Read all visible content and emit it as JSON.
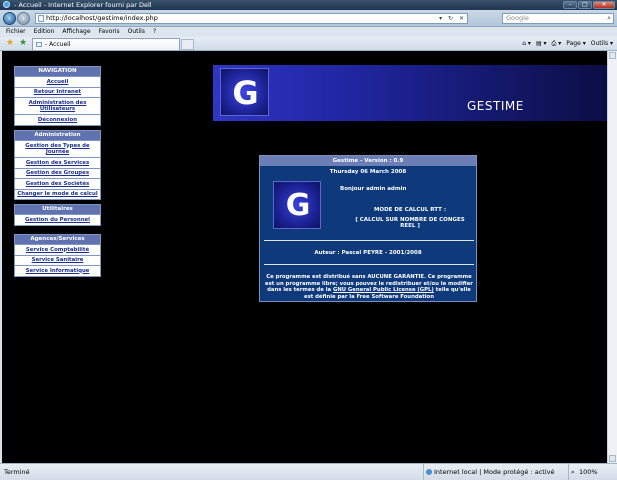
{
  "window": {
    "title": "- Accueil - Internet Explorer fourni par Dell",
    "controls": [
      "–",
      "□",
      "✕"
    ]
  },
  "addressbar": {
    "url": "http://localhost/gestime/index.php",
    "tail_icons": "▾ ↻ ✕",
    "search_placeholder": "Google",
    "search_icon": "⌕"
  },
  "menubar": [
    "Fichier",
    "Edition",
    "Affichage",
    "Favoris",
    "Outils",
    "?"
  ],
  "tab": {
    "label": "- Accueil"
  },
  "commandbar": [
    "⌂ ▾",
    "▤ ▾",
    "⎙ ▾",
    "Page ▾",
    "Outils ▾"
  ],
  "sidebar": {
    "navigation": {
      "heading": "NAVIGATION",
      "items": [
        "Accueil",
        "Retour Intranet",
        "Administration des Utilisateurs",
        "Déconnexion"
      ]
    },
    "administration": {
      "heading": "Administration",
      "items": [
        "Gestion des Types de Journée",
        "Gestion des Services",
        "Gestion des Groupes",
        "Gestion des Sociétés",
        "Changer le mode de calcul"
      ]
    },
    "utilitaires": {
      "heading": "Utilitaires",
      "items": [
        "Gestion du Personnel"
      ]
    },
    "agences": {
      "heading": "Agences/Services",
      "items": [
        "Service Comptabilité",
        "Service Sanitaire",
        "Service Informatique"
      ]
    }
  },
  "banner": {
    "logo_letter": "G",
    "title": "GESTIME"
  },
  "info": {
    "heading": "Gestime - Version : 0.9",
    "date": "Thursday 06 March 2008",
    "logo_letter": "G",
    "greeting": "Bonjour admin admin",
    "mode_title": "MODE DE CALCUL RTT :",
    "mode_value": "[ CALCUL SUR NOMBRE DE CONGES REEL ]",
    "author": "Auteur : Pascal PEYRE - 2001/2008",
    "license_before": "Ce programme est distribué sans AUCUNE GARANTIE. Ce programme est un programme libre; vous pouvez le redistribuer et/ou le modifier dans les termes de la",
    "license_link": "GNU General Public License (GPL)",
    "license_after": "telle qu'elle est définie par la Free Software Foundation"
  },
  "status": {
    "text": "Terminé",
    "zone": "Internet local | Mode protégé : activé",
    "zoom": "100%"
  },
  "colors": {
    "page_bg": "#000000",
    "menu_header": "#6073b0",
    "menu_link": "#1c2f8c",
    "panel_bg": "#0e3a7c",
    "banner_start": "#2f36c4",
    "banner_end": "#0b0d45"
  }
}
